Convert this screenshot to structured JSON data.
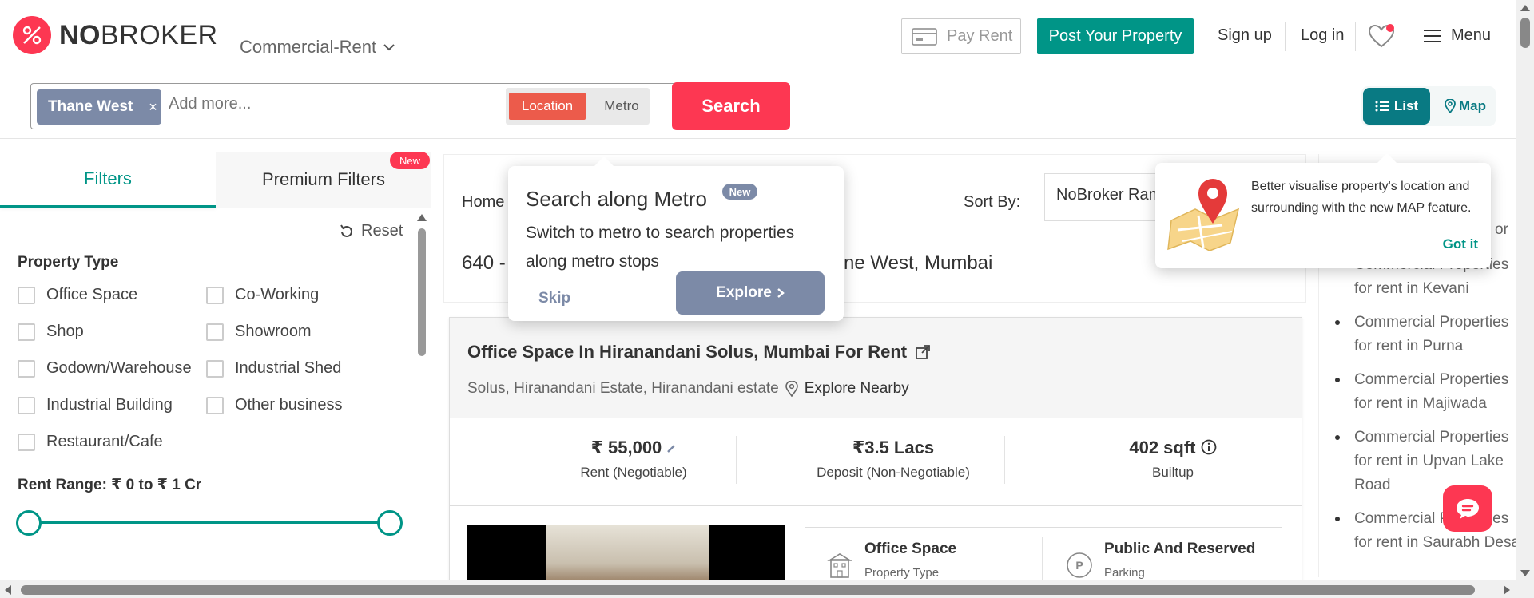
{
  "header": {
    "brand_bold": "NO",
    "brand_light": "BROKER",
    "category": "Commercial-Rent",
    "pay_rent": "Pay Rent",
    "post_property": "Post Your Property",
    "sign_up": "Sign up",
    "log_in": "Log in",
    "menu": "Menu"
  },
  "search": {
    "chip": "Thane West",
    "chip_remove": "×",
    "placeholder": "Add more...",
    "mode_location": "Location",
    "mode_metro": "Metro",
    "button": "Search",
    "view_list": "List",
    "view_map": "Map"
  },
  "filters": {
    "tab_filters": "Filters",
    "tab_premium": "Premium Filters",
    "new_badge": "New",
    "reset": "Reset",
    "property_type_title": "Property Type",
    "property_types": [
      "Office Space",
      "Co-Working",
      "Shop",
      "Showroom",
      "Godown/Warehouse",
      "Industrial Shed",
      "Industrial Building",
      "Other business",
      "Restaurant/Cafe"
    ],
    "rent_range": "Rent Range: ₹ 0 to ₹ 1 Cr",
    "rent_min_fraction": 0,
    "rent_max_fraction": 1
  },
  "listing": {
    "breadcrumb": "Home",
    "sort_label": "Sort By:",
    "sort_value": "NoBroker Ran",
    "result_title_left": "640 -",
    "result_title_right": "ane West, Mumbai"
  },
  "card": {
    "title": "Office Space In Hiranandani Solus, Mumbai For Rent",
    "address": "Solus, Hiranandani Estate, Hiranandani estate",
    "explore_nearby": "Explore Nearby",
    "rent_value": "₹ 55,000",
    "rent_label": "Rent (Negotiable)",
    "deposit_value": "₹3.5 Lacs",
    "deposit_label": "Deposit (Non-Negotiable)",
    "area_value": "402 sqft",
    "area_label": "Builtup",
    "detail1_title": "Office Space",
    "detail1_sub": "Property Type",
    "detail2_title": "Public And Reserved",
    "detail2_sub": "Parking",
    "detail2_icon_letter": "P"
  },
  "sidebar": {
    "partial_top": "or",
    "items": [
      "Commercial Properties for rent in Kevani",
      "Commercial Properties for rent in Purna",
      "Commercial Properties for rent in Majiwada",
      "Commercial Properties for rent in Upvan Lake Road",
      "Commercial Properties for rent in Saurabh Desai"
    ]
  },
  "metro_popover": {
    "title": "Search along Metro",
    "badge": "New",
    "body": "Switch to metro to search properties along metro stops",
    "skip": "Skip",
    "explore": "Explore"
  },
  "map_popover": {
    "body": "Better visualise property's location and surrounding with the new MAP feature.",
    "got_it": "Got it"
  },
  "colors": {
    "brand_red": "#fd3752",
    "teal": "#009587",
    "dark_teal": "#097a83",
    "slate": "#7c8aa7"
  },
  "icons": [
    "logo-icon",
    "chevron-down-icon",
    "credit-card-icon",
    "heart-icon",
    "hamburger-menu-icon",
    "close-icon",
    "list-icon",
    "map-pin-icon",
    "reset-icon",
    "external-link-icon",
    "location-pin-icon",
    "edit-icon",
    "info-icon",
    "building-icon",
    "parking-icon",
    "chevron-right-icon",
    "map-illustration-icon",
    "chat-icon"
  ]
}
